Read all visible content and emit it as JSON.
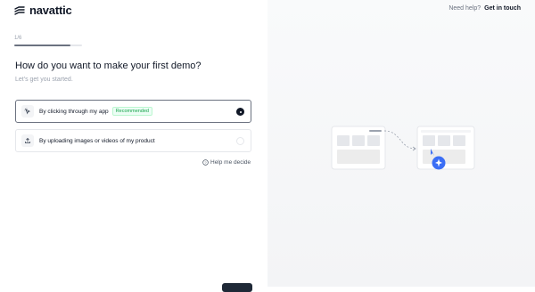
{
  "brand": {
    "name": "navattic"
  },
  "header": {
    "help_text": "Need help?",
    "contact_link": "Get in touch"
  },
  "progress": {
    "step_label": "1/6",
    "fraction": 0.83
  },
  "question": {
    "title": "How do you want to make your first demo?",
    "subtitle": "Let's get you started."
  },
  "options": [
    {
      "label": "By clicking through my app",
      "badge": "Recommended",
      "selected": true,
      "icon": "cursor-click-icon"
    },
    {
      "label": "By uploading images or videos of my product",
      "badge": "",
      "selected": false,
      "icon": "upload-icon"
    }
  ],
  "help_decide": {
    "label": "Help me decide",
    "icon": "help-circle-icon"
  },
  "colors": {
    "accent": "#3b6ef5",
    "selected_border": "#6b7280",
    "badge_text": "#16a34a"
  }
}
